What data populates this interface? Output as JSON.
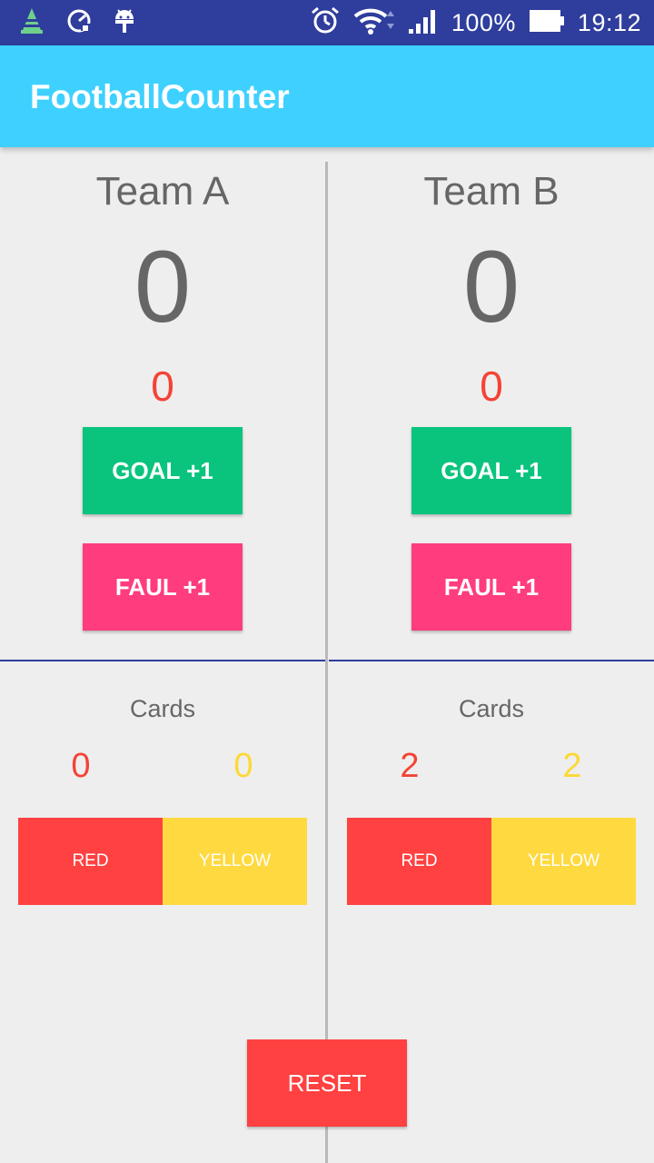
{
  "status_bar": {
    "battery": "100%",
    "time": "19:12",
    "icons": [
      "cone-app-icon",
      "speed-wrench-icon",
      "android-debug-icon",
      "alarm-icon",
      "wifi-icon",
      "signal-icon",
      "battery-icon"
    ]
  },
  "app_bar": {
    "title": "FootballCounter"
  },
  "team_a": {
    "name": "Team A",
    "score": "0",
    "fouls": "0",
    "goal_label": "GOAL +1",
    "faul_label": "FAUL +1",
    "cards_title": "Cards",
    "red_count": "0",
    "yellow_count": "0",
    "red_label": "RED",
    "yellow_label": "YELLOW"
  },
  "team_b": {
    "name": "Team B",
    "score": "0",
    "fouls": "0",
    "goal_label": "GOAL +1",
    "faul_label": "FAUL +1",
    "cards_title": "Cards",
    "red_count": "2",
    "yellow_count": "2",
    "red_label": "RED",
    "yellow_label": "YELLOW"
  },
  "reset_label": "RESET",
  "colors": {
    "status_bar": "#2f3d9c",
    "app_bar": "#3ed1ff",
    "goal": "#0ac47e",
    "faul": "#ff3c7e",
    "red_card": "#ff4141",
    "yellow_card": "#ffd940",
    "foul_text": "#f44336",
    "yellow_text": "#fdd835"
  }
}
